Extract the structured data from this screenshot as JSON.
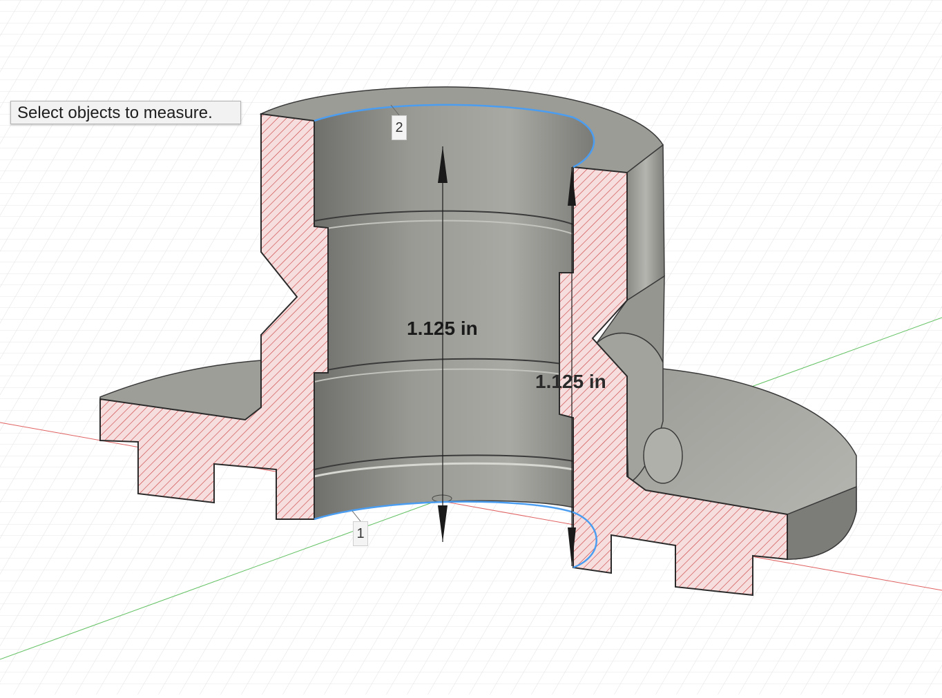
{
  "tooltip": {
    "text": "Select objects to measure."
  },
  "labels": {
    "point1": "1",
    "point2": "2"
  },
  "measurements": {
    "primary": "1.125 in",
    "secondary": "1.125 in"
  },
  "colors": {
    "section_fill": "#f7dede",
    "hatch": "#c83a3a",
    "body_grey": "#8f8f8a",
    "edge_highlight": "#4a9df0",
    "axis_x": "#e06060",
    "axis_y": "#60c060"
  }
}
